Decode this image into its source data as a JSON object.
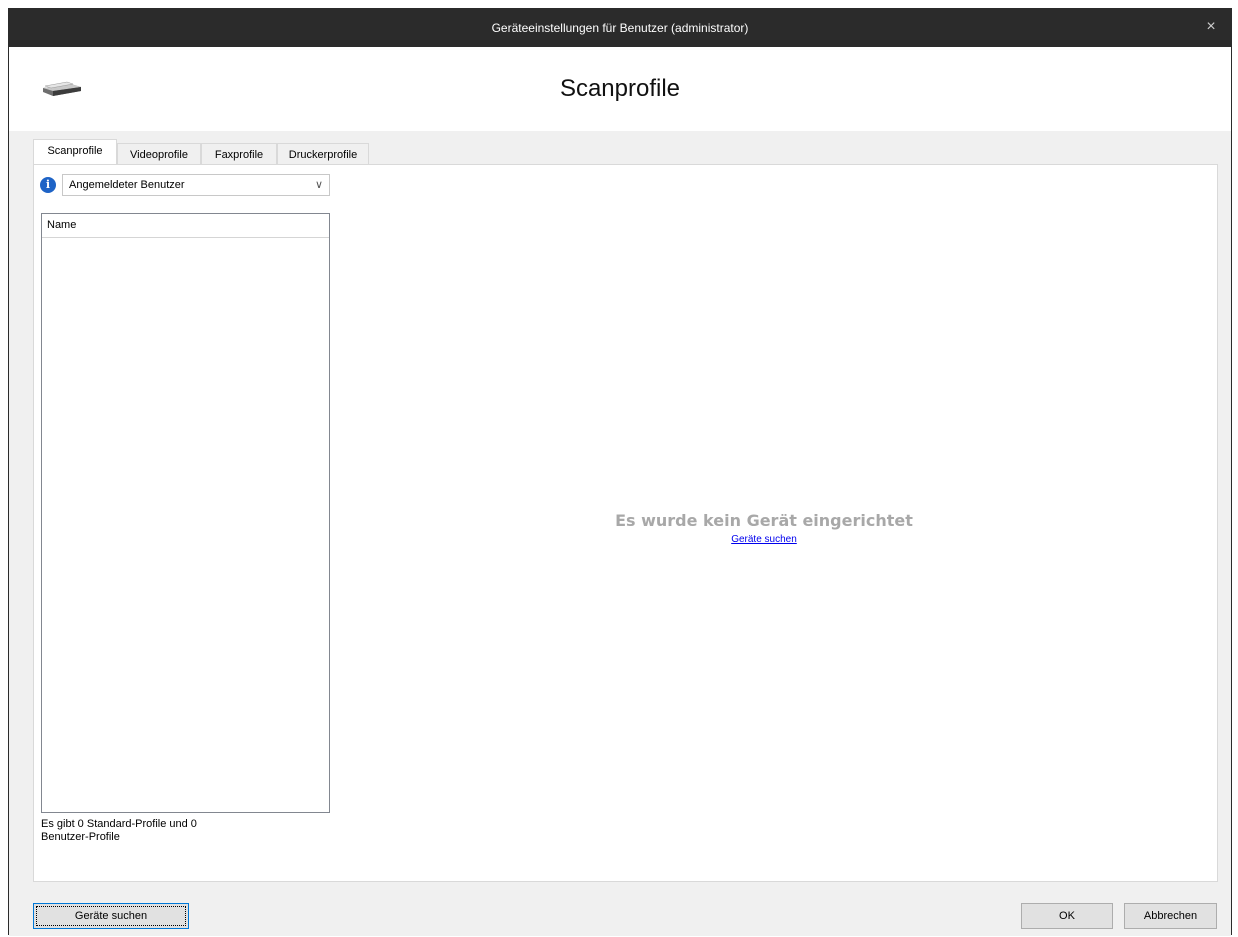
{
  "window": {
    "title": "Geräteeinstellungen für Benutzer (administrator)",
    "close_glyph": "×"
  },
  "header": {
    "title": "Scanprofile",
    "icon": "scanner-icon"
  },
  "tabs": [
    {
      "label": "Scanprofile",
      "active": true
    },
    {
      "label": "Videoprofile",
      "active": false
    },
    {
      "label": "Faxprofile",
      "active": false
    },
    {
      "label": "Druckerprofile",
      "active": false
    }
  ],
  "filter": {
    "info_glyph": "i",
    "selected": "Angemeldeter Benutzer",
    "chevron": "∨"
  },
  "list": {
    "column_name": "Name",
    "rows": []
  },
  "summary": {
    "line1": "Es gibt 0 Standard-Profile und 0",
    "line2": "Benutzer-Profile"
  },
  "empty_state": {
    "message": "Es wurde kein Gerät eingerichtet",
    "link": "Geräte suchen"
  },
  "footer": {
    "search_button": "Geräte suchen",
    "ok_button": "OK",
    "cancel_button": "Abbrechen"
  },
  "colors": {
    "titlebar": "#2b2b2b",
    "link": "#0000ee",
    "muted_text": "#a8a8a8",
    "info_icon": "#1e63c6"
  }
}
